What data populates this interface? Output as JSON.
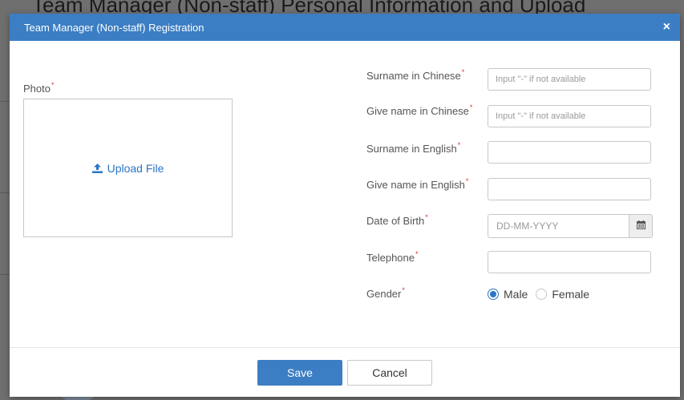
{
  "background": {
    "heading_fragment": "Team Manager (Non-staff) Personal Information and Upload"
  },
  "modal": {
    "title": "Team Manager (Non-staff) Registration",
    "close_label": "×",
    "header_color": "#3c7ec3"
  },
  "photo": {
    "label": "Photo",
    "required_mark": "*",
    "upload_label": "Upload File",
    "upload_icon": "upload-icon"
  },
  "fields": {
    "surname_cn": {
      "label": "Surname in Chinese",
      "required_mark": "*",
      "placeholder": "Input \"-\" if not available",
      "value": ""
    },
    "given_cn": {
      "label": "Give name in Chinese",
      "required_mark": "*",
      "placeholder": "Input \"-\" if not available",
      "value": ""
    },
    "surname_en": {
      "label": "Surname in English",
      "required_mark": "*",
      "placeholder": "",
      "value": ""
    },
    "given_en": {
      "label": "Give name in English",
      "required_mark": "*",
      "placeholder": "",
      "value": ""
    },
    "dob": {
      "label": "Date of Birth",
      "required_mark": "*",
      "placeholder": "DD-MM-YYYY",
      "value": "",
      "icon": "calendar-icon"
    },
    "telephone": {
      "label": "Telephone",
      "required_mark": "*",
      "placeholder": "",
      "value": ""
    },
    "gender": {
      "label": "Gender",
      "required_mark": "*",
      "options": [
        "Male",
        "Female"
      ],
      "selected": "Male"
    }
  },
  "footer": {
    "save_label": "Save",
    "cancel_label": "Cancel"
  },
  "colors": {
    "accent": "#3c7ec3",
    "link": "#2a75c4",
    "required": "#e03030"
  }
}
